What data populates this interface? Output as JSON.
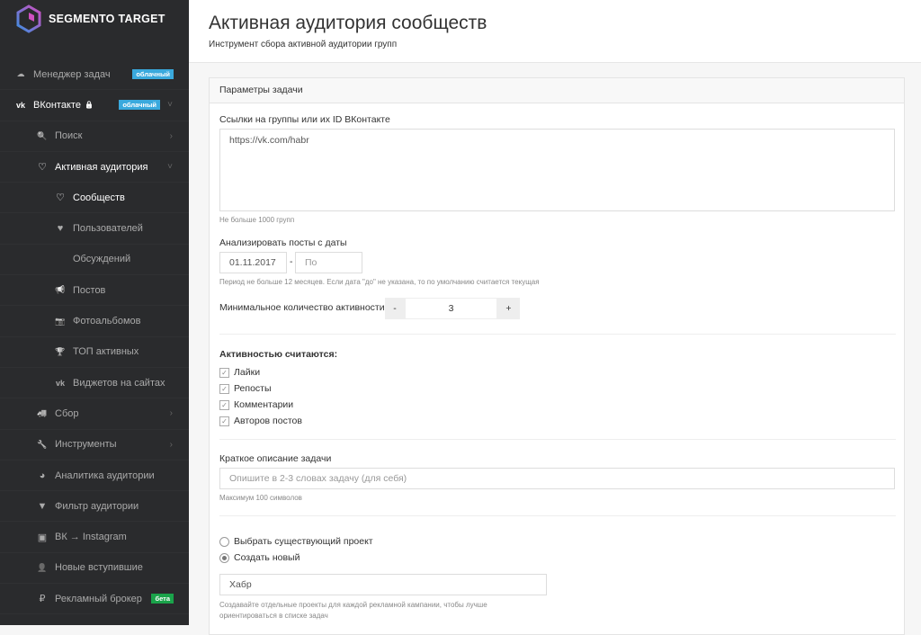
{
  "brand": "SEGMENTO TARGET",
  "sidebar": [
    {
      "label": "Менеджер задач",
      "icon": "cloud-icon",
      "g": "☁",
      "lvl": 0,
      "badge": "облачный",
      "badge_color": "#3aa9dd"
    },
    {
      "label": "ВКонтакте",
      "icon": "vk-icon",
      "g": "vk",
      "lvl": 0,
      "badge": "облачный",
      "badge_color": "#3aa9dd",
      "lock": "🔒",
      "chev": "˅",
      "on": true
    },
    {
      "label": "Поиск",
      "icon": "search-icon",
      "g": "🔍",
      "lvl": 1,
      "chev": "›"
    },
    {
      "label": "Активная аудитория",
      "icon": "heart-outline-icon",
      "g": "♡",
      "lvl": 1,
      "chev": "˅",
      "on": true
    },
    {
      "label": "Сообществ",
      "icon": "heart-outline-icon",
      "g": "♡",
      "lvl": 2,
      "on": true
    },
    {
      "label": "Пользователей",
      "icon": "heart-icon",
      "g": "♥",
      "lvl": 2
    },
    {
      "label": "Обсуждений",
      "icon": "",
      "g": "",
      "lvl": 2
    },
    {
      "label": "Постов",
      "icon": "bullhorn-icon",
      "g": "📢",
      "lvl": 2
    },
    {
      "label": "Фотоальбомов",
      "icon": "camera-icon",
      "g": "📷",
      "lvl": 2
    },
    {
      "label": "ТОП активных",
      "icon": "trophy-icon",
      "g": "🏆",
      "lvl": 2
    },
    {
      "label": "Виджетов на сайтах",
      "icon": "vk-icon",
      "g": "vk",
      "lvl": 2
    },
    {
      "label": "Сбор",
      "icon": "truck-icon",
      "g": "🚚",
      "lvl": 1,
      "chev": "›"
    },
    {
      "label": "Инструменты",
      "icon": "wrench-icon",
      "g": "🔧",
      "lvl": 1,
      "chev": "›"
    },
    {
      "label": "Аналитика аудитории",
      "icon": "pie-chart-icon",
      "g": "◕",
      "lvl": 1
    },
    {
      "label": "Фильтр аудитории",
      "icon": "filter-icon",
      "g": "▼",
      "lvl": 1
    },
    {
      "label": "ВК → Instagram",
      "icon": "instagram-icon",
      "g": "▣",
      "lvl": 1
    },
    {
      "label": "Новые вступившие",
      "icon": "user-plus-icon",
      "g": "👤",
      "lvl": 1
    },
    {
      "label": "Рекламный брокер",
      "icon": "ruble-icon",
      "g": "₽",
      "lvl": 1,
      "badge": "бета",
      "badge_color": "#1aa34a"
    }
  ],
  "header": {
    "title": "Активная аудитория сообществ",
    "subtitle": "Инструмент сбора активной аудитории групп"
  },
  "form": {
    "panel_title": "Параметры задачи",
    "groups_label": "Ссылки на группы или их ID ВКонтакте",
    "groups_value": "https://vk.com/habr",
    "groups_hint": "Не больше 1000 групп",
    "date_label": "Анализировать посты с даты",
    "date_from": "01.11.2017",
    "date_sep": "-",
    "date_to_placeholder": "По",
    "date_hint": "Период не больше 12 месяцев. Если дата \"до\" не указана, то по умолчанию считается текущая",
    "min_label": "Минимальное количество активности",
    "minus": "-",
    "min_value": "3",
    "plus": "+",
    "activity_title": "Активностью считаются:",
    "activities": [
      {
        "label": "Лайки",
        "checked": true
      },
      {
        "label": "Репосты",
        "checked": true
      },
      {
        "label": "Комментарии",
        "checked": true
      },
      {
        "label": "Авторов постов",
        "checked": true
      }
    ],
    "desc_label": "Краткое описание задачи",
    "desc_placeholder": "Опишите в 2-3 словах задачу (для себя)",
    "desc_hint": "Максимум 100 символов",
    "radio_existing": "Выбрать существующий проект",
    "radio_new": "Создать новый",
    "project_value": "Хабр",
    "project_hint1": "Создавайте отдельные проекты для каждой рекламной кампании, чтобы лучше",
    "project_hint2": "ориентироваться в списке задач"
  }
}
